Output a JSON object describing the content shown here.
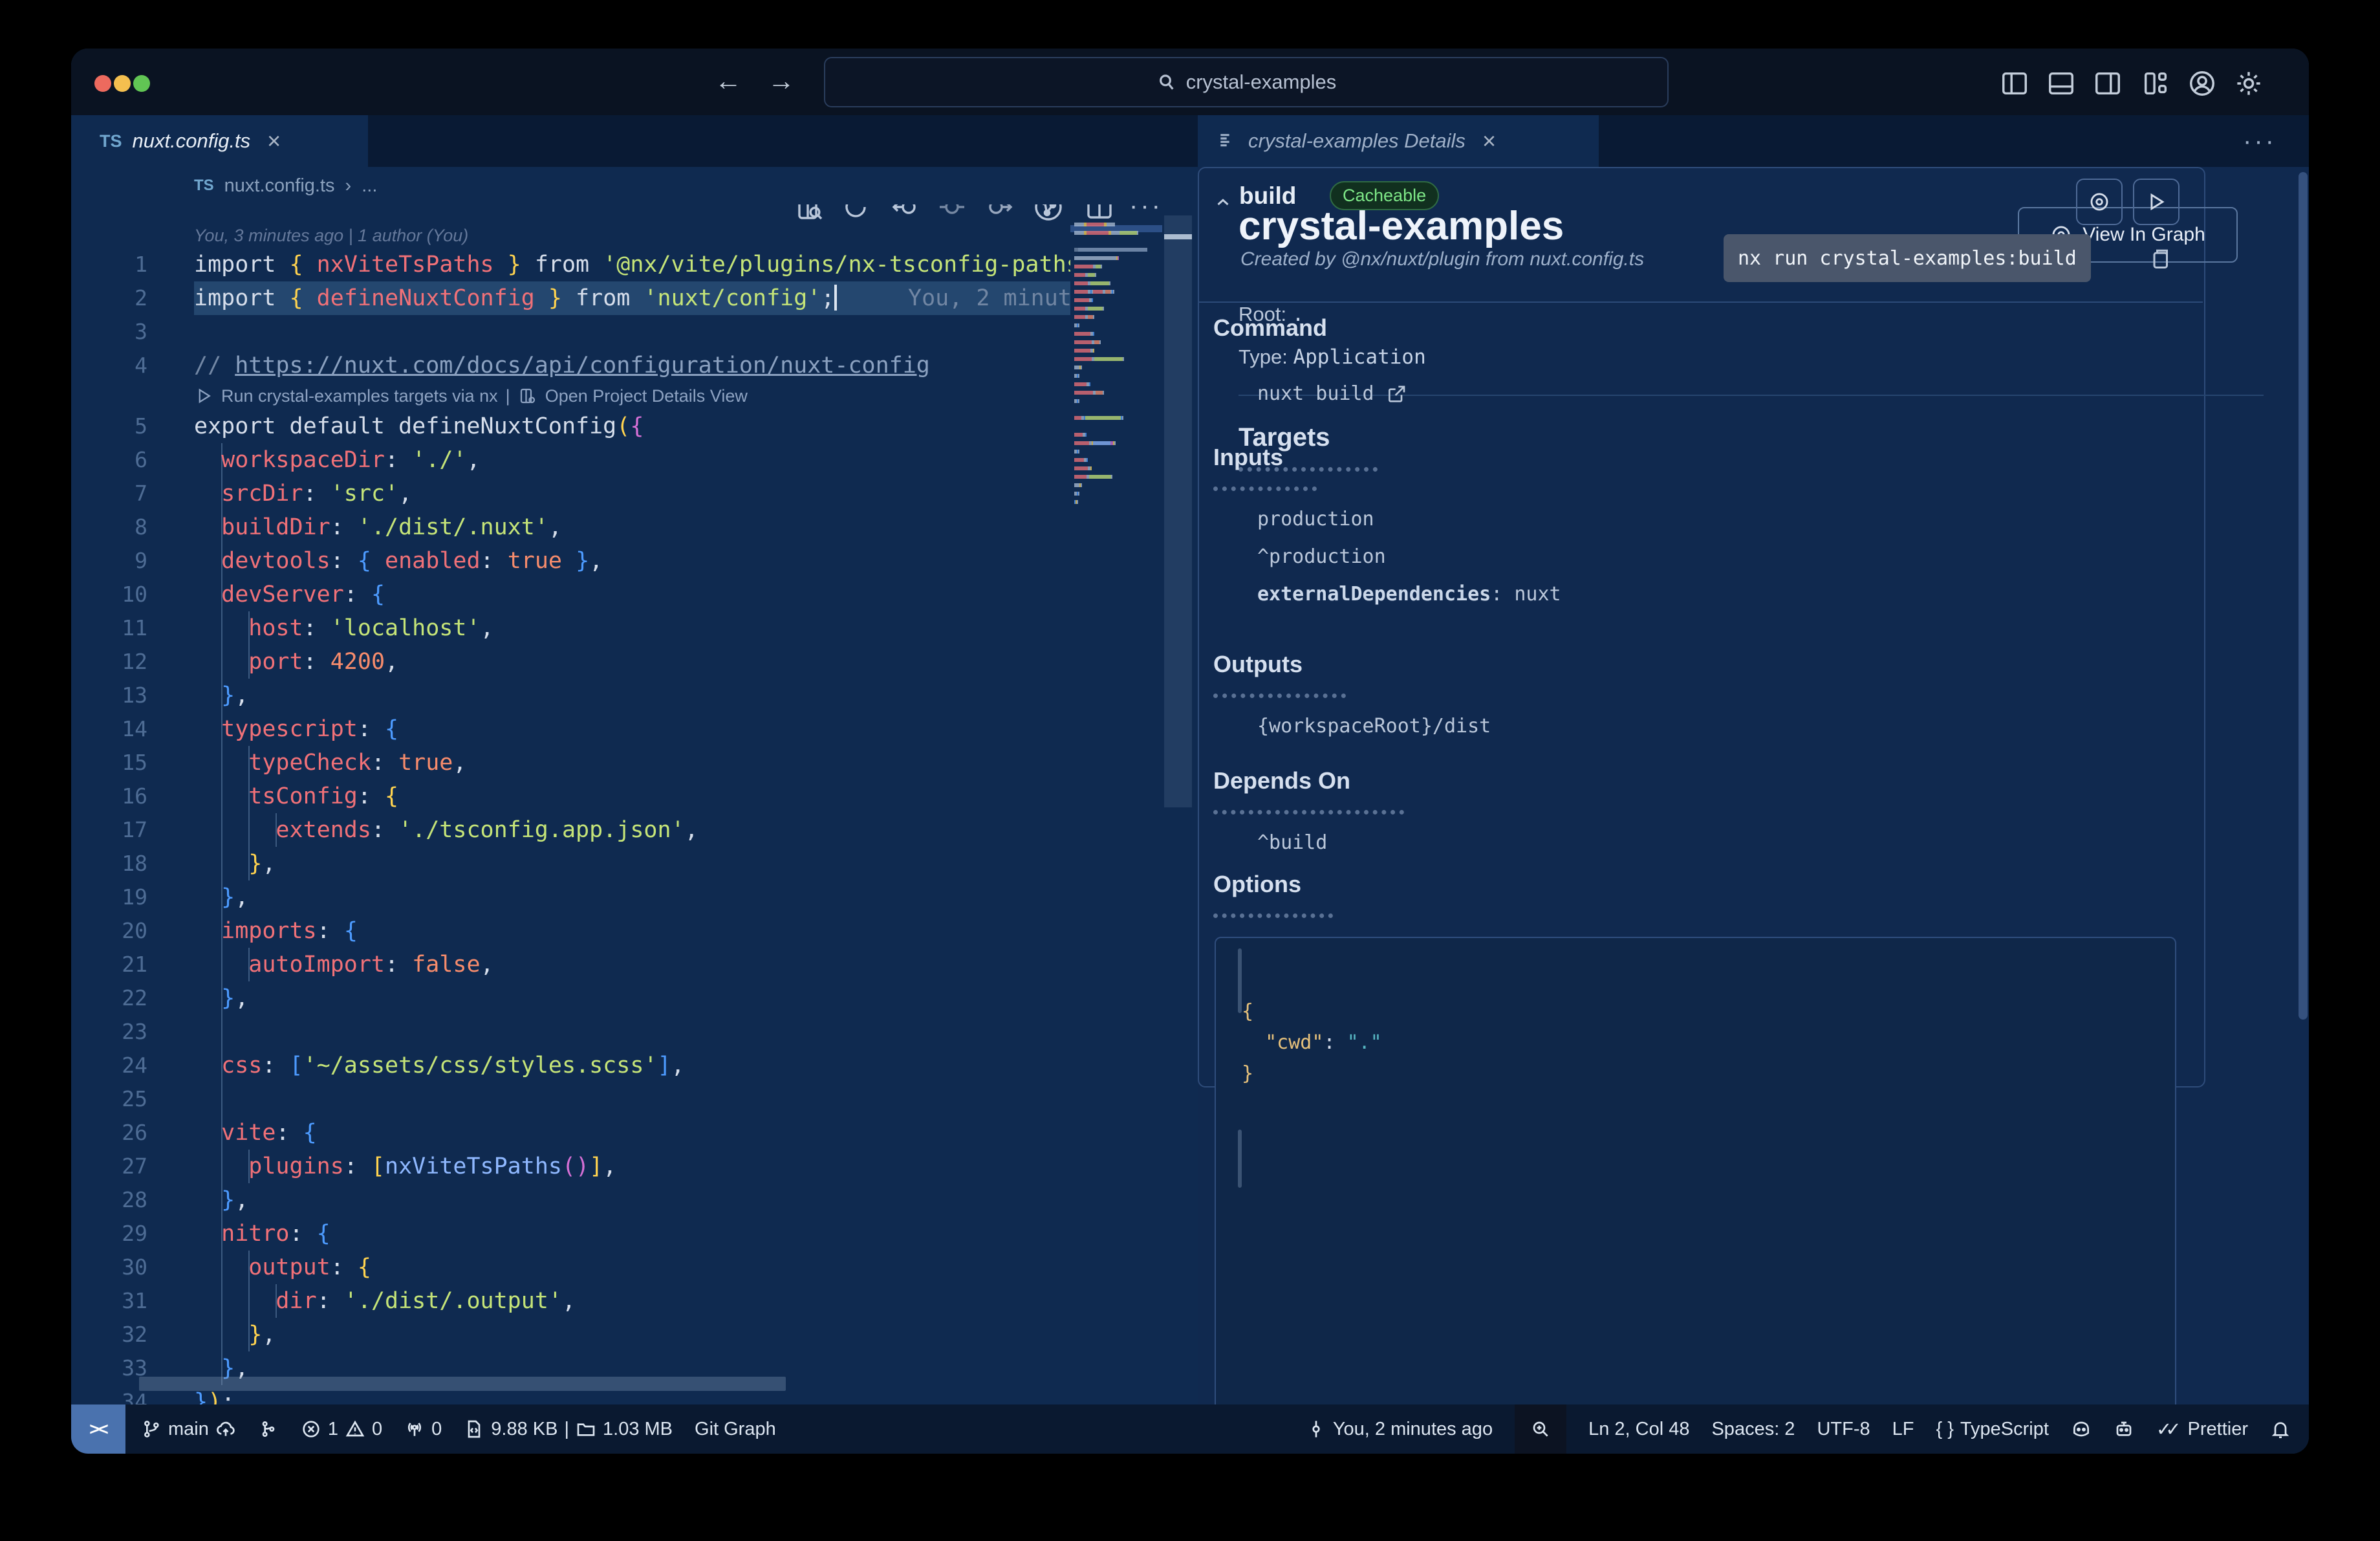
{
  "colors": {
    "editor_bg": "#0f2a50",
    "panel_bg": "#10294f",
    "chrome_bg": "#0a1322",
    "tabbar_bg": "#091a34",
    "status_bg": "#0a1930",
    "accent_remote": "#4a72ae",
    "selection_line": "#24476f",
    "badge_green": "#7ee787",
    "gold": "#ffd34f",
    "orchid": "#d670d6",
    "bracket_blue": "#4d9bff",
    "salmon": "#f07178",
    "string_green": "#c5e478",
    "orange": "#f78c6c",
    "func_blue": "#8fb8ff",
    "comment": "#7388a5",
    "json_key": "#e5c07b",
    "json_value": "#56b6c2"
  },
  "titlebar": {
    "search_value": "crystal-examples",
    "back": "←",
    "forward": "→"
  },
  "editor": {
    "tab": {
      "ts_badge": "TS",
      "filename": "nuxt.config.ts",
      "close": "×"
    },
    "breadcrumb": {
      "ts_badge": "TS",
      "file": "nuxt.config.ts",
      "sep": "›",
      "more": "..."
    },
    "codelens": {
      "run": "Run crystal-examples targets via nx",
      "sep": "|",
      "open": "Open Project Details View"
    },
    "rows": [
      {
        "type": "meta",
        "text": "You, 3 minutes ago | 1 author (You)"
      },
      {
        "type": "code",
        "n": "1",
        "g": 0,
        "segs": [
          [
            "w",
            "import "
          ],
          [
            "y",
            "{ "
          ],
          [
            "p",
            "nxViteTsPaths"
          ],
          [
            "y",
            " }"
          ],
          [
            "w",
            " from "
          ],
          [
            "s",
            "'@nx/vite/plugins/nx-tsconfig-paths"
          ]
        ]
      },
      {
        "type": "code",
        "n": "2",
        "g": 0,
        "hl": true,
        "cursor": true,
        "ghost": "You, 2 minut",
        "segs": [
          [
            "w",
            "import "
          ],
          [
            "y",
            "{ "
          ],
          [
            "p",
            "defineNuxtConfig"
          ],
          [
            "y",
            " }"
          ],
          [
            "w",
            " from "
          ],
          [
            "s",
            "'nuxt/config'"
          ],
          [
            "w",
            ";"
          ]
        ]
      },
      {
        "type": "code",
        "n": "3",
        "g": 0,
        "segs": []
      },
      {
        "type": "code",
        "n": "4",
        "g": 0,
        "segs": [
          [
            "c",
            "// "
          ],
          [
            "u",
            "https://nuxt.com/docs/api/configuration/nuxt-config"
          ]
        ]
      },
      {
        "type": "lens"
      },
      {
        "type": "code",
        "n": "5",
        "g": 0,
        "segs": [
          [
            "w",
            "export default defineNuxtConfig"
          ],
          [
            "y",
            "("
          ],
          [
            "m",
            "{"
          ]
        ]
      },
      {
        "type": "code",
        "n": "6",
        "g": 1,
        "segs": [
          [
            "p",
            "  workspaceDir"
          ],
          [
            "w",
            ": "
          ],
          [
            "s",
            "'./'"
          ],
          [
            "w",
            ","
          ]
        ]
      },
      {
        "type": "code",
        "n": "7",
        "g": 1,
        "segs": [
          [
            "p",
            "  srcDir"
          ],
          [
            "w",
            ": "
          ],
          [
            "s",
            "'src'"
          ],
          [
            "w",
            ","
          ]
        ]
      },
      {
        "type": "code",
        "n": "8",
        "g": 1,
        "segs": [
          [
            "p",
            "  buildDir"
          ],
          [
            "w",
            ": "
          ],
          [
            "s",
            "'./dist/.nuxt'"
          ],
          [
            "w",
            ","
          ]
        ]
      },
      {
        "type": "code",
        "n": "9",
        "g": 1,
        "segs": [
          [
            "p",
            "  devtools"
          ],
          [
            "w",
            ": "
          ],
          [
            "b",
            "{"
          ],
          [
            "w",
            " "
          ],
          [
            "p",
            "enabled"
          ],
          [
            "w",
            ": "
          ],
          [
            "o",
            "true"
          ],
          [
            "w",
            " "
          ],
          [
            "b",
            "}"
          ],
          [
            "w",
            ","
          ]
        ]
      },
      {
        "type": "code",
        "n": "10",
        "g": 1,
        "segs": [
          [
            "p",
            "  devServer"
          ],
          [
            "w",
            ": "
          ],
          [
            "b",
            "{"
          ]
        ]
      },
      {
        "type": "code",
        "n": "11",
        "g": 2,
        "segs": [
          [
            "p",
            "    host"
          ],
          [
            "w",
            ": "
          ],
          [
            "s",
            "'localhost'"
          ],
          [
            "w",
            ","
          ]
        ]
      },
      {
        "type": "code",
        "n": "12",
        "g": 2,
        "segs": [
          [
            "p",
            "    port"
          ],
          [
            "w",
            ": "
          ],
          [
            "o",
            "4200"
          ],
          [
            "w",
            ","
          ]
        ]
      },
      {
        "type": "code",
        "n": "13",
        "g": 1,
        "segs": [
          [
            "w",
            "  "
          ],
          [
            "b",
            "}"
          ],
          [
            "w",
            ","
          ]
        ]
      },
      {
        "type": "code",
        "n": "14",
        "g": 1,
        "segs": [
          [
            "p",
            "  typescript"
          ],
          [
            "w",
            ": "
          ],
          [
            "b",
            "{"
          ]
        ]
      },
      {
        "type": "code",
        "n": "15",
        "g": 2,
        "segs": [
          [
            "p",
            "    typeCheck"
          ],
          [
            "w",
            ": "
          ],
          [
            "o",
            "true"
          ],
          [
            "w",
            ","
          ]
        ]
      },
      {
        "type": "code",
        "n": "16",
        "g": 2,
        "segs": [
          [
            "p",
            "    tsConfig"
          ],
          [
            "w",
            ": "
          ],
          [
            "y",
            "{"
          ]
        ]
      },
      {
        "type": "code",
        "n": "17",
        "g": 3,
        "segs": [
          [
            "p",
            "      extends"
          ],
          [
            "w",
            ": "
          ],
          [
            "s",
            "'./tsconfig.app.json'"
          ],
          [
            "w",
            ","
          ]
        ]
      },
      {
        "type": "code",
        "n": "18",
        "g": 2,
        "segs": [
          [
            "w",
            "    "
          ],
          [
            "y",
            "}"
          ],
          [
            "w",
            ","
          ]
        ]
      },
      {
        "type": "code",
        "n": "19",
        "g": 1,
        "segs": [
          [
            "w",
            "  "
          ],
          [
            "b",
            "}"
          ],
          [
            "w",
            ","
          ]
        ]
      },
      {
        "type": "code",
        "n": "20",
        "g": 1,
        "segs": [
          [
            "p",
            "  imports"
          ],
          [
            "w",
            ": "
          ],
          [
            "b",
            "{"
          ]
        ]
      },
      {
        "type": "code",
        "n": "21",
        "g": 2,
        "segs": [
          [
            "p",
            "    autoImport"
          ],
          [
            "w",
            ": "
          ],
          [
            "o",
            "false"
          ],
          [
            "w",
            ","
          ]
        ]
      },
      {
        "type": "code",
        "n": "22",
        "g": 1,
        "segs": [
          [
            "w",
            "  "
          ],
          [
            "b",
            "}"
          ],
          [
            "w",
            ","
          ]
        ]
      },
      {
        "type": "code",
        "n": "23",
        "g": 1,
        "segs": []
      },
      {
        "type": "code",
        "n": "24",
        "g": 1,
        "segs": [
          [
            "p",
            "  css"
          ],
          [
            "w",
            ": "
          ],
          [
            "b",
            "["
          ],
          [
            "s",
            "'~/assets/css/styles.scss'"
          ],
          [
            "b",
            "]"
          ],
          [
            "w",
            ","
          ]
        ]
      },
      {
        "type": "code",
        "n": "25",
        "g": 1,
        "segs": []
      },
      {
        "type": "code",
        "n": "26",
        "g": 1,
        "segs": [
          [
            "p",
            "  vite"
          ],
          [
            "w",
            ": "
          ],
          [
            "b",
            "{"
          ]
        ]
      },
      {
        "type": "code",
        "n": "27",
        "g": 2,
        "segs": [
          [
            "p",
            "    plugins"
          ],
          [
            "w",
            ": "
          ],
          [
            "y",
            "["
          ],
          [
            "f",
            "nxViteTsPaths"
          ],
          [
            "m",
            "()"
          ],
          [
            "y",
            "]"
          ],
          [
            "w",
            ","
          ]
        ]
      },
      {
        "type": "code",
        "n": "28",
        "g": 1,
        "segs": [
          [
            "w",
            "  "
          ],
          [
            "b",
            "}"
          ],
          [
            "w",
            ","
          ]
        ]
      },
      {
        "type": "code",
        "n": "29",
        "g": 1,
        "segs": [
          [
            "p",
            "  nitro"
          ],
          [
            "w",
            ": "
          ],
          [
            "b",
            "{"
          ]
        ]
      },
      {
        "type": "code",
        "n": "30",
        "g": 2,
        "segs": [
          [
            "p",
            "    output"
          ],
          [
            "w",
            ": "
          ],
          [
            "y",
            "{"
          ]
        ]
      },
      {
        "type": "code",
        "n": "31",
        "g": 3,
        "segs": [
          [
            "p",
            "      dir"
          ],
          [
            "w",
            ": "
          ],
          [
            "s",
            "'./dist/.output'"
          ],
          [
            "w",
            ","
          ]
        ]
      },
      {
        "type": "code",
        "n": "32",
        "g": 2,
        "segs": [
          [
            "w",
            "    "
          ],
          [
            "y",
            "}"
          ],
          [
            "w",
            ","
          ]
        ]
      },
      {
        "type": "code",
        "n": "33",
        "g": 1,
        "segs": [
          [
            "w",
            "  "
          ],
          [
            "b",
            "}"
          ],
          [
            "w",
            ","
          ]
        ]
      },
      {
        "type": "code",
        "n": "34",
        "g": 0,
        "segs": [
          [
            "b",
            "}"
          ],
          [
            "y",
            ")"
          ],
          [
            "w",
            ";"
          ]
        ]
      }
    ]
  },
  "panel": {
    "tab": {
      "label": "crystal-examples Details",
      "close": "×",
      "more": "···"
    },
    "title": "crystal-examples",
    "view_in_graph": "View In Graph",
    "root_label": "Root:",
    "root_value": ".",
    "type_label": "Type:",
    "type_value": "Application",
    "targets_heading": "Targets",
    "build": {
      "name": "build",
      "badge": "Cacheable",
      "created_by": "Created by @nx/nuxt/plugin from nuxt.config.ts",
      "command_chip": "nx run crystal-examples:build",
      "command_heading": "Command",
      "command_value": "nuxt build",
      "inputs_heading": "Inputs",
      "inputs_items": [
        "production",
        "^production"
      ],
      "inputs_kv_key": "externalDependencies",
      "inputs_kv_value": ": nuxt",
      "outputs_heading": "Outputs",
      "outputs_items": [
        "{workspaceRoot}/dist"
      ],
      "depends_heading": "Depends On",
      "depends_items": [
        "^build"
      ],
      "options_heading": "Options",
      "options_lines": [
        [
          [
            "jb",
            "{"
          ]
        ],
        [
          [
            "jw",
            "  "
          ],
          [
            "jk",
            "\"cwd\""
          ],
          [
            "jw",
            ": "
          ],
          [
            "jv",
            "\".\""
          ]
        ],
        [
          [
            "jb",
            "}"
          ]
        ]
      ]
    }
  },
  "status": {
    "remote": "><",
    "branch": "main",
    "graph_label": "",
    "errors": "1",
    "warnings": "0",
    "ports": "0",
    "file_size": "9.88 KB",
    "divider": "|",
    "folder_size": "1.03 MB",
    "git_graph": "Git Graph",
    "blame": "You, 2 minutes ago",
    "cursor_pos": "Ln 2, Col 48",
    "spaces": "Spaces: 2",
    "encoding": "UTF-8",
    "eol": "LF",
    "braces": "{ }",
    "language": "TypeScript",
    "checks": "✓✓",
    "prettier": "Prettier"
  }
}
